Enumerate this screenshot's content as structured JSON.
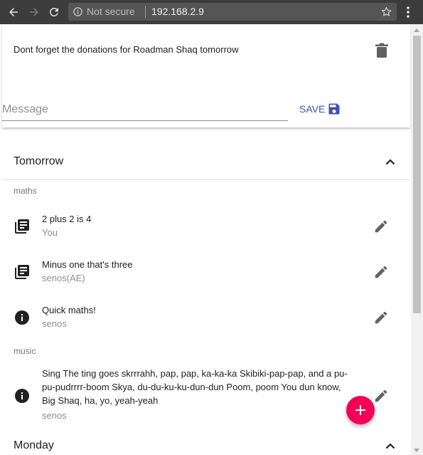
{
  "browser": {
    "security_label": "Not secure",
    "url": "192.168.2.9"
  },
  "top_card": {
    "reminder": "Dont forget the donations for Roadman Shaq tomorrow",
    "message_placeholder": "Message",
    "message_value": "",
    "save_label": "SAVE"
  },
  "sections": [
    {
      "title": "Tomorrow",
      "groups": [
        {
          "subject": "maths",
          "items": [
            {
              "text": "2 plus 2 is 4",
              "author": "You",
              "icon": "note-stack-icon"
            },
            {
              "text": "Minus one that's three",
              "author": "senos(AE)",
              "icon": "note-stack-icon"
            },
            {
              "text": "Quick maths!",
              "author": "senos",
              "icon": "info-icon"
            }
          ]
        },
        {
          "subject": "music",
          "items": [
            {
              "text": "Sing The ting goes skrrrahh, pap, pap, ka-ka-ka Skibiki-pap-pap, and a pu-pu-pudrrrr-boom Skya, du-du-ku-ku-dun-dun Poom, poom You dun know, Big Shaq, ha, yo, yeah-yeah",
              "author": "senos",
              "icon": "info-icon"
            }
          ]
        }
      ]
    },
    {
      "title": "Monday",
      "groups": []
    }
  ],
  "colors": {
    "accent": "#3f51b5",
    "fab": "#f50057",
    "chrome": "#3c3c3c"
  }
}
